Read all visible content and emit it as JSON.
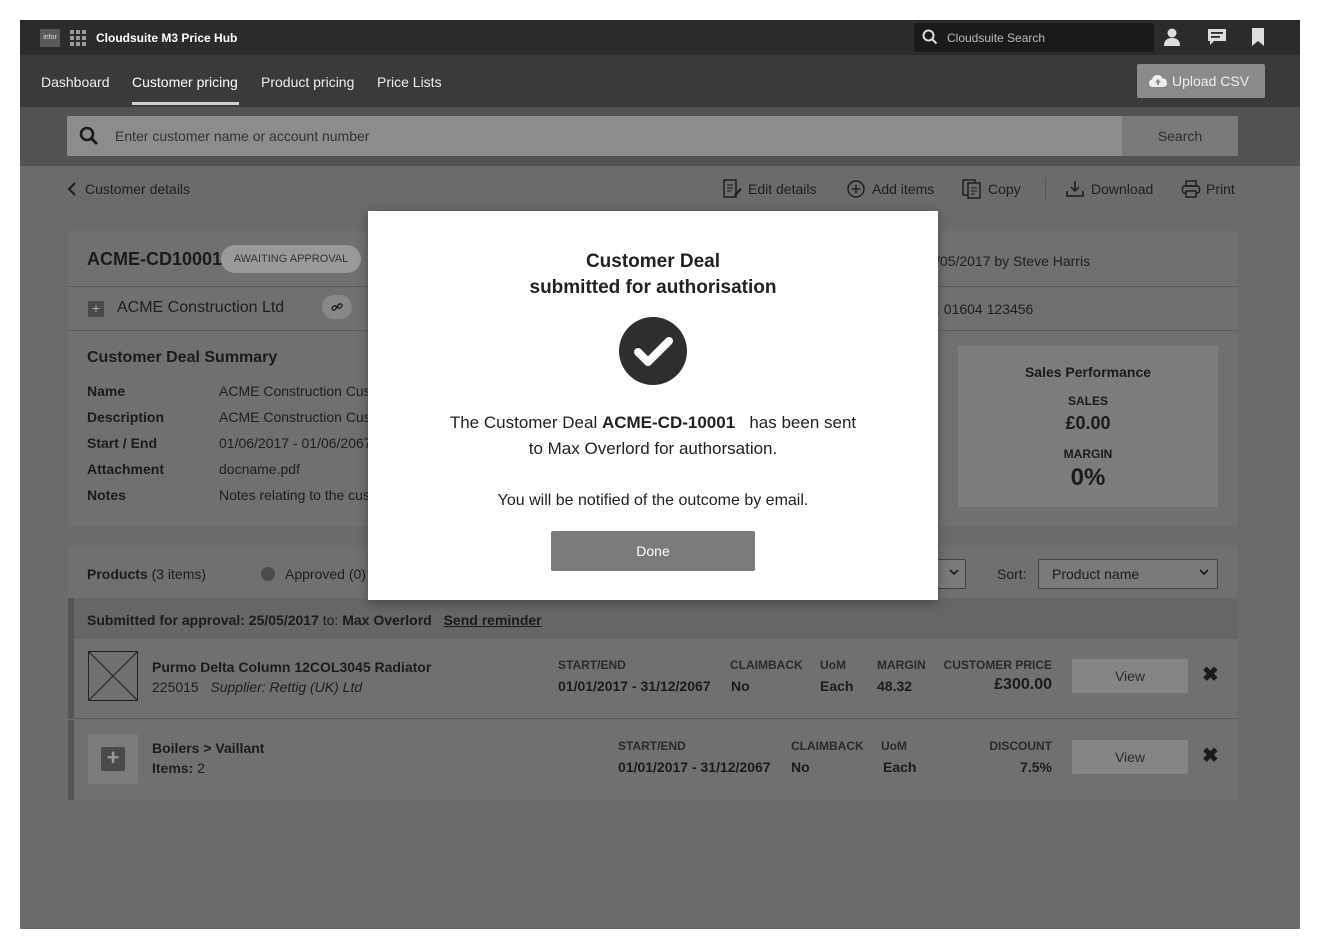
{
  "app": {
    "logo_text": "infor",
    "title": "Cloudsuite M3 Price Hub",
    "search_placeholder": "Cloudsuite Search"
  },
  "nav": {
    "items": [
      "Dashboard",
      "Customer pricing",
      "Product pricing",
      "Price Lists"
    ],
    "active": "Customer pricing",
    "upload_label": "Upload CSV"
  },
  "customer_search": {
    "placeholder": "Enter customer name or account number",
    "button": "Search"
  },
  "toolbar": {
    "back_label": "Customer details",
    "edit": "Edit details",
    "add": "Add items",
    "copy": "Copy",
    "download": "Download",
    "print": "Print"
  },
  "deal": {
    "id": "ACME-CD10001",
    "status": "AWAITING APPROVAL",
    "meta": "/05/2017 by Steve Harris",
    "customer": "ACME Construction Ltd",
    "tel": ". 01604 123456",
    "summary_title": "Customer Deal Summary",
    "fields": [
      {
        "key": "Name",
        "value": "ACME Construction Cus"
      },
      {
        "key": "Description",
        "value": "ACME Construction Cus"
      },
      {
        "key": "Start / End",
        "value": "01/06/2017 - 01/06/2067"
      },
      {
        "key": "Attachment",
        "value": "docname.pdf"
      },
      {
        "key": "Notes",
        "value": "Notes relating to the cus"
      }
    ],
    "performance": {
      "title": "Sales Performance",
      "sales_label": "SALES",
      "sales_value": "£0.00",
      "margin_label": "MARGIN",
      "margin_value": "0%"
    }
  },
  "products": {
    "title": "Products",
    "count": "(3 items)",
    "approved": "Approved (0)",
    "sort_label": "Sort:",
    "sort_value": "Product name",
    "submitted": {
      "label": "Submitted for approval: 25/05/2017",
      "to": " to: ",
      "name": "Max Overlord",
      "reminder": "Send reminder"
    },
    "rows": [
      {
        "name": "Purmo Delta Column 12COL3045 Radiator",
        "code": "225015",
        "supplier": "Supplier: Rettig (UK) Ltd",
        "h1": "START/END",
        "v1": "01/01/2017 - 31/12/2067",
        "h2": "CLAIMBACK",
        "v2": "No",
        "h3": "UoM",
        "v3": "Each",
        "h4": "MARGIN",
        "v4": "48.32",
        "h5": "CUSTOMER PRICE",
        "v5": "£300.00",
        "view": "View"
      },
      {
        "name": "Boilers > Vaillant",
        "items_label": "Items:",
        "items_value": "2",
        "h1": "START/END",
        "v1": "01/01/2017 - 31/12/2067",
        "h2": "CLAIMBACK",
        "v2": "No",
        "h3": "UoM",
        "v3": "Each",
        "h5": "DISCOUNT",
        "v5": "7.5%",
        "view": "View"
      }
    ]
  },
  "modal": {
    "title_line1": "Customer Deal",
    "title_line2": "submitted for authorisation",
    "body_prefix": "The Customer Deal ",
    "body_id": "ACME-CD-10001",
    "body_suffix": "   has been sent",
    "body_line2": "to Max Overlord for authorsation.",
    "note": "You will be notified of the outcome by email.",
    "done": "Done"
  },
  "colors": {
    "topbar": "#2b2b2b",
    "overlay": "#6b6b6b",
    "modal_bg": "#ffffff",
    "check_circle": "#2e2e2e",
    "done_button": "#7b7b7b"
  }
}
